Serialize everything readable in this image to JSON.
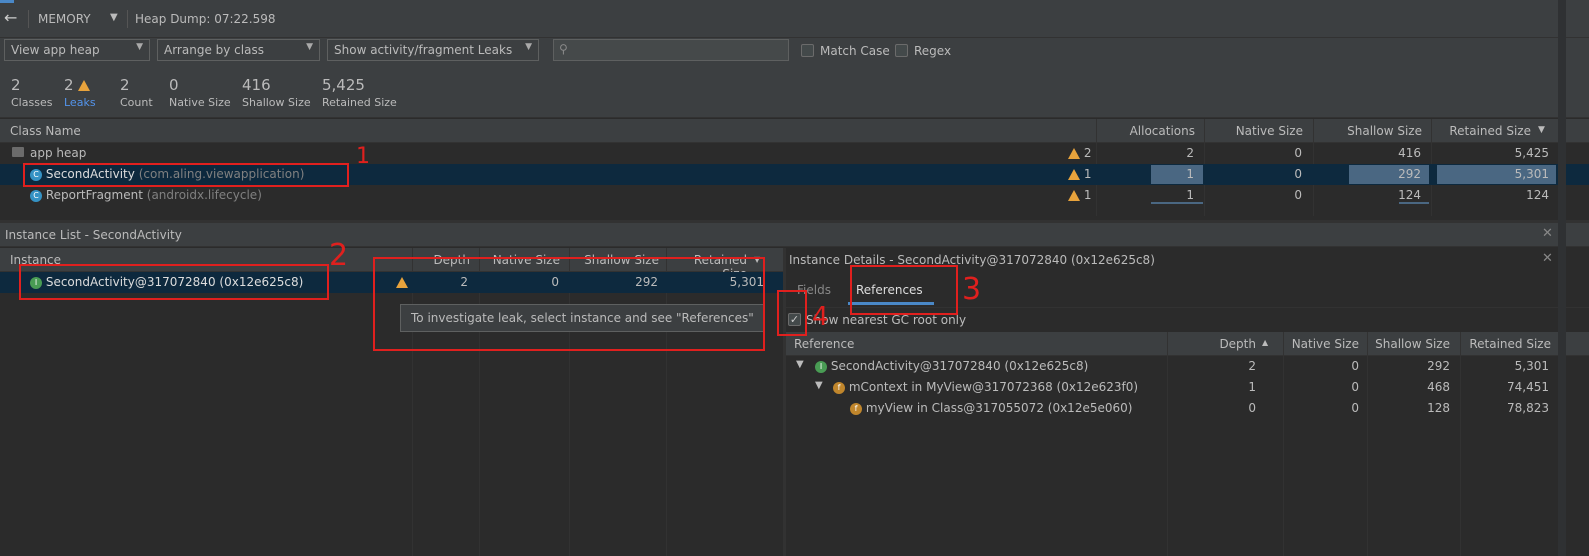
{
  "toolbar": {
    "memory_label": "MEMORY",
    "heap_dump": "Heap Dump: 07:22.598"
  },
  "filters": {
    "heap": "View app heap",
    "arrange": "Arrange by class",
    "leaks": "Show activity/fragment Leaks",
    "search_placeholder": "",
    "match_case": "Match Case",
    "regex": "Regex"
  },
  "stats": [
    {
      "value": "2",
      "label": "Classes"
    },
    {
      "value": "2",
      "label": "Leaks"
    },
    {
      "value": "2",
      "label": "Count"
    },
    {
      "value": "0",
      "label": "Native Size"
    },
    {
      "value": "416",
      "label": "Shallow Size"
    },
    {
      "value": "5,425",
      "label": "Retained Size"
    }
  ],
  "class_table": {
    "headers": {
      "name": "Class Name",
      "allocations": "Allocations",
      "native": "Native Size",
      "shallow": "Shallow Size",
      "retained": "Retained Size"
    },
    "rows": [
      {
        "name": "app heap",
        "pkg": "",
        "leaks": "2",
        "allocations": "2",
        "native": "0",
        "shallow": "416",
        "retained": "5,425"
      },
      {
        "name": "SecondActivity",
        "pkg": "(com.aling.viewapplication)",
        "leaks": "1",
        "allocations": "1",
        "native": "0",
        "shallow": "292",
        "retained": "5,301"
      },
      {
        "name": "ReportFragment",
        "pkg": "(androidx.lifecycle)",
        "leaks": "1",
        "allocations": "1",
        "native": "0",
        "shallow": "124",
        "retained": "124"
      }
    ]
  },
  "instance_list": {
    "title": "Instance List - SecondActivity",
    "headers": {
      "instance": "Instance",
      "depth": "Depth",
      "native": "Native Size",
      "shallow": "Shallow Size",
      "retained": "Retained Size"
    },
    "rows": [
      {
        "name": "SecondActivity@317072840 (0x12e625c8)",
        "depth": "2",
        "native": "0",
        "shallow": "292",
        "retained": "5,301"
      }
    ],
    "tooltip": "To investigate leak, select instance and see \"References\""
  },
  "instance_details": {
    "title": "Instance Details - SecondActivity@317072840 (0x12e625c8)",
    "tabs": [
      "Fields",
      "References"
    ],
    "gc_root_label": "Show nearest GC root only",
    "headers": {
      "reference": "Reference",
      "depth": "Depth",
      "native": "Native Size",
      "shallow": "Shallow Size",
      "retained": "Retained Size"
    },
    "rows": [
      {
        "name": "SecondActivity@317072840 (0x12e625c8)",
        "depth": "2",
        "native": "0",
        "shallow": "292",
        "retained": "5,301"
      },
      {
        "name": "mContext in MyView@317072368 (0x12e623f0)",
        "depth": "1",
        "native": "0",
        "shallow": "468",
        "retained": "74,451"
      },
      {
        "name": "myView in Class@317055072 (0x12e5e060)",
        "depth": "0",
        "native": "0",
        "shallow": "128",
        "retained": "78,823"
      }
    ]
  },
  "annotations": [
    "1",
    "2",
    "3",
    "4"
  ]
}
